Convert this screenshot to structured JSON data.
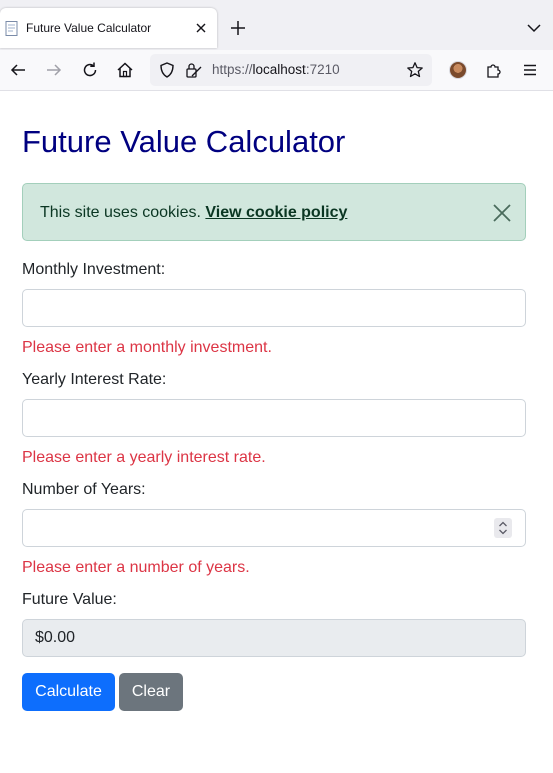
{
  "browser": {
    "tab_title": "Future Value Calculator",
    "url_scheme": "https://",
    "url_host": "localhost",
    "url_port": ":7210"
  },
  "page": {
    "title": "Future Value Calculator",
    "alert": {
      "text": "This site uses cookies.",
      "link": "View cookie policy"
    },
    "fields": {
      "monthly_investment": {
        "label": "Monthly Investment:",
        "value": "",
        "error": "Please enter a monthly investment."
      },
      "yearly_interest_rate": {
        "label": "Yearly Interest Rate:",
        "value": "",
        "error": "Please enter a yearly interest rate."
      },
      "number_of_years": {
        "label": "Number of Years:",
        "value": "",
        "error": "Please enter a number of years."
      },
      "future_value": {
        "label": "Future Value:",
        "value": "$0.00"
      }
    },
    "buttons": {
      "calculate": "Calculate",
      "clear": "Clear"
    }
  },
  "colors": {
    "title": "#000080",
    "alert_bg": "#d1e7dd",
    "error": "#dc3545",
    "primary": "#0d6efd",
    "secondary": "#6c757d"
  }
}
